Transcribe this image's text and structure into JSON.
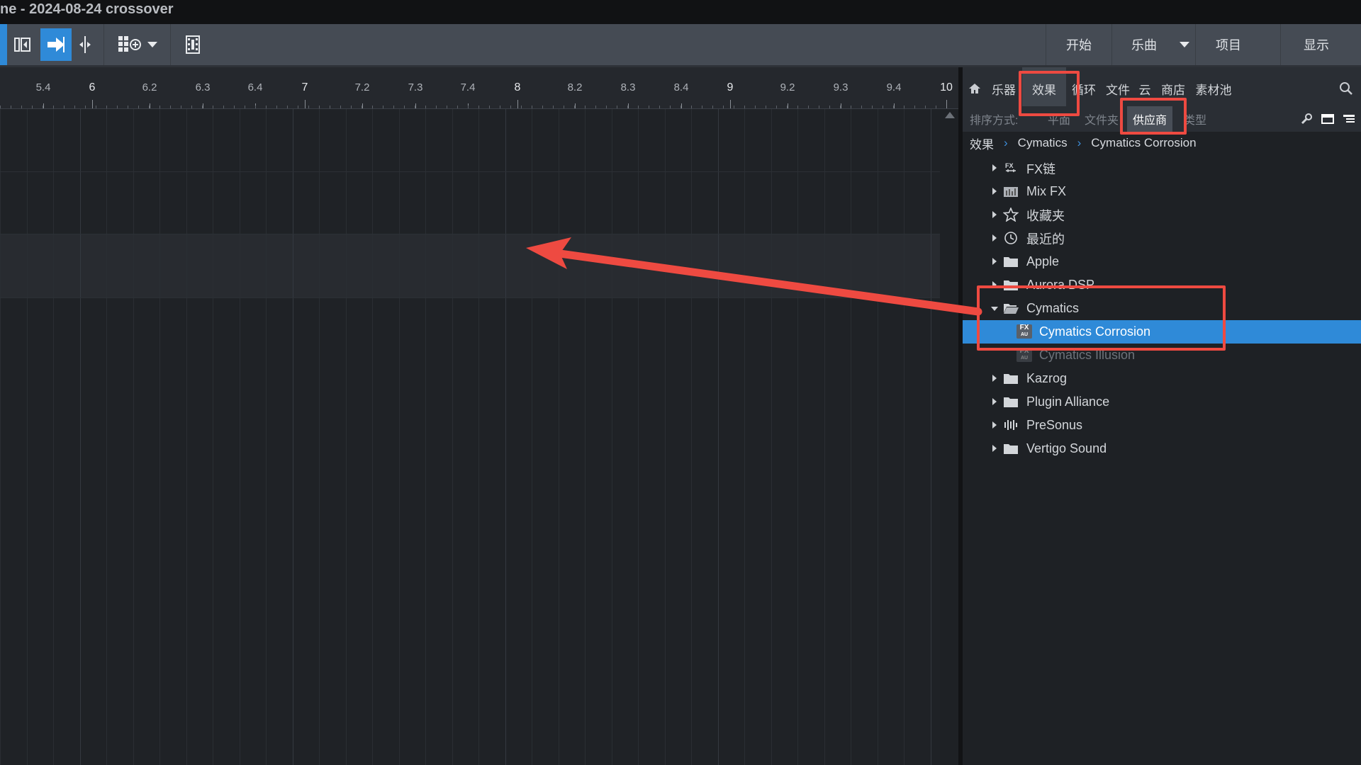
{
  "window": {
    "title": "ne - 2024-08-24 crossover"
  },
  "toolbar": {
    "tools": [
      {
        "name": "split-tool-icon",
        "active": false
      },
      {
        "name": "arrow-right-icon",
        "active": true
      },
      {
        "name": "split-cursor-icon",
        "active": false
      },
      {
        "name": "grid-add-icon",
        "active": false
      },
      {
        "name": "dropdown-arrow-icon",
        "active": false
      },
      {
        "name": "film-icon",
        "active": false
      }
    ],
    "nav": {
      "start": "开始",
      "song": "乐曲",
      "project": "项目",
      "show": "显示"
    }
  },
  "ruler": {
    "labels": [
      "5.4",
      "6",
      "6.2",
      "6.3",
      "6.4",
      "7",
      "7.2",
      "7.3",
      "7.4",
      "8",
      "8.2",
      "8.3",
      "8.4",
      "9",
      "9.2",
      "9.3",
      "9.4",
      "10"
    ]
  },
  "browser": {
    "tabs": [
      "乐器",
      "效果",
      "循环",
      "文件",
      "云",
      "商店",
      "素材池"
    ],
    "selected_tab": "效果",
    "sort": {
      "label": "排序方式:",
      "options": [
        "平面",
        "文件夹",
        "供应商",
        "类型"
      ],
      "selected": "供应商"
    },
    "breadcrumb": [
      "效果",
      "Cymatics",
      "Cymatics Corrosion"
    ],
    "items": [
      {
        "label": "FX链",
        "icon": "fx-chain-icon",
        "expanded": false
      },
      {
        "label": "Mix FX",
        "icon": "mix-fx-icon",
        "expanded": false
      },
      {
        "label": "收藏夹",
        "icon": "star-icon",
        "expanded": false
      },
      {
        "label": "最近的",
        "icon": "clock-icon",
        "expanded": false
      },
      {
        "label": "Apple",
        "icon": "folder-icon",
        "expanded": false
      },
      {
        "label": "Aurora DSP",
        "icon": "folder-icon",
        "expanded": false
      },
      {
        "label": "Cymatics",
        "icon": "folder-open-icon",
        "expanded": true
      },
      {
        "label": "Cymatics Corrosion",
        "icon": "fx-plugin-icon",
        "selected": true,
        "child": true
      },
      {
        "label": "Cymatics Illusion",
        "icon": "fx-plugin-icon",
        "child": true,
        "faded": true
      },
      {
        "label": "Kazrog",
        "icon": "folder-icon",
        "expanded": false
      },
      {
        "label": "Plugin Alliance",
        "icon": "folder-icon",
        "expanded": false
      },
      {
        "label": "PreSonus",
        "icon": "presonus-icon",
        "expanded": false
      },
      {
        "label": "Vertigo Sound",
        "icon": "folder-icon",
        "expanded": false
      }
    ],
    "fx_badge": "FX",
    "au_badge": "AU"
  },
  "colors": {
    "accent": "#2f8ad8",
    "annotation": "#ee4a41"
  }
}
